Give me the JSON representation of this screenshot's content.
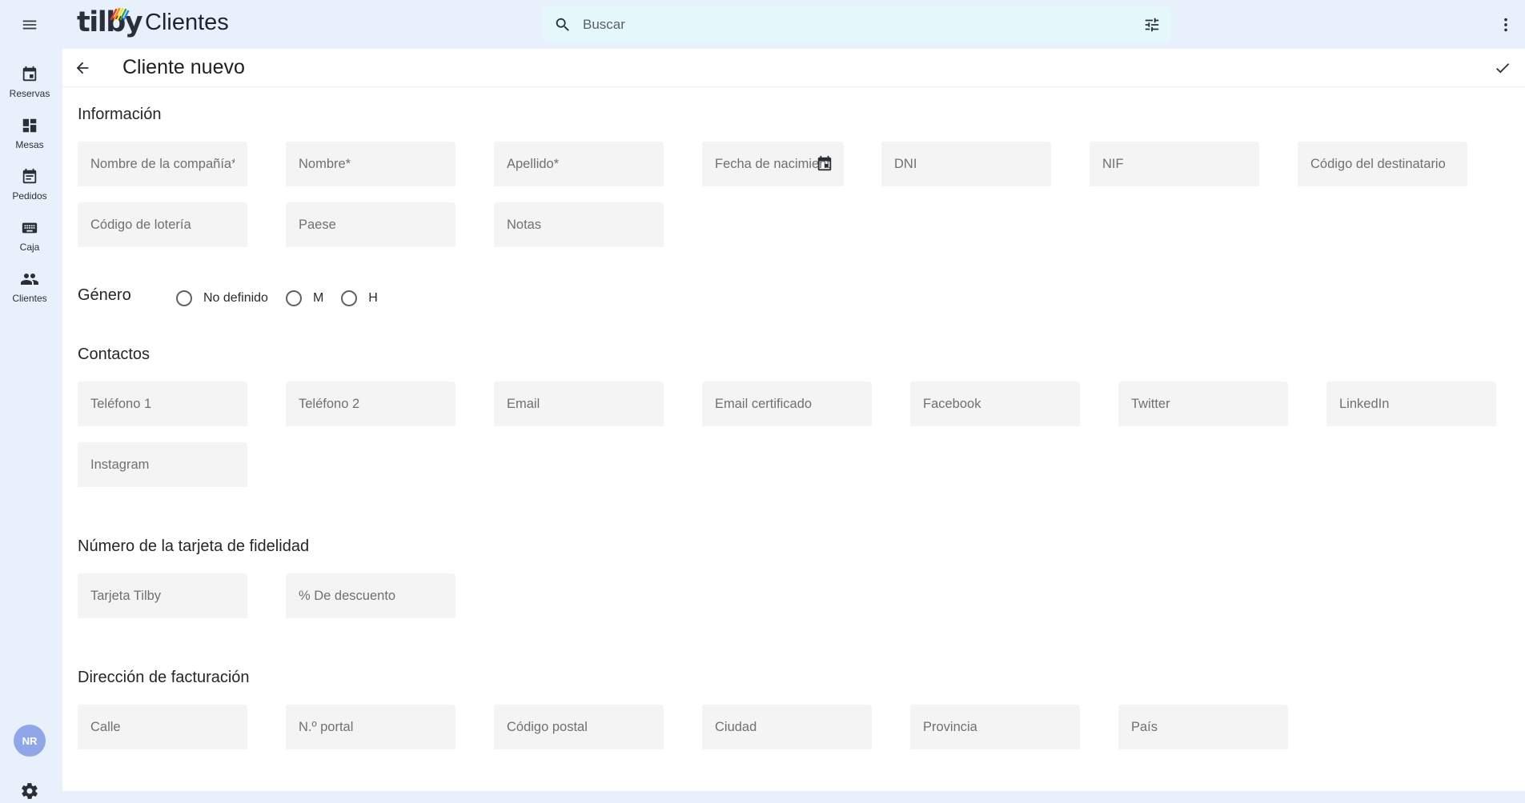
{
  "app": {
    "brand": "tilby",
    "title": "Clientes",
    "brand_colors": [
      "#e53935",
      "#fb8c00",
      "#fdd835",
      "#43a047",
      "#1e88e5",
      "#8e24aa"
    ]
  },
  "search": {
    "placeholder": "Buscar"
  },
  "sidebar": {
    "items": [
      {
        "label": "Reservas",
        "icon": "calendar-icon"
      },
      {
        "label": "Mesas",
        "icon": "dashboard-icon"
      },
      {
        "label": "Pedidos",
        "icon": "event-note-icon"
      },
      {
        "label": "Caja",
        "icon": "keyboard-icon"
      },
      {
        "label": "Clientes",
        "icon": "people-icon"
      }
    ],
    "avatar": "NR"
  },
  "page": {
    "title": "Cliente nuevo"
  },
  "sections": {
    "info": {
      "title": "Información",
      "fields": [
        "Nombre de la compañía*",
        "Nombre*",
        "Apellido*",
        "Fecha de nacimiento",
        "DNI",
        "NIF",
        "Código del destinatario",
        "Código de lotería",
        "Paese",
        "Notas"
      ]
    },
    "gender": {
      "title": "Género",
      "options": [
        "No definido",
        "M",
        "H"
      ]
    },
    "contacts": {
      "title": "Contactos",
      "fields": [
        "Teléfono 1",
        "Teléfono 2",
        "Email",
        "Email certificado",
        "Facebook",
        "Twitter",
        "LinkedIn",
        "Instagram"
      ]
    },
    "fidelity": {
      "title": "Número de la tarjeta de fidelidad",
      "fields": [
        "Tarjeta Tilby",
        "% De descuento"
      ]
    },
    "billing": {
      "title": "Dirección de facturación",
      "fields": [
        "Calle",
        "N.º portal",
        "Código postal",
        "Ciudad",
        "Provincia",
        "País"
      ]
    }
  },
  "colors": {
    "background": "#e8f1fb",
    "search_bg": "#e4f7fa",
    "field_bg": "#f4f4f4",
    "avatar": "#8fa6e8"
  }
}
